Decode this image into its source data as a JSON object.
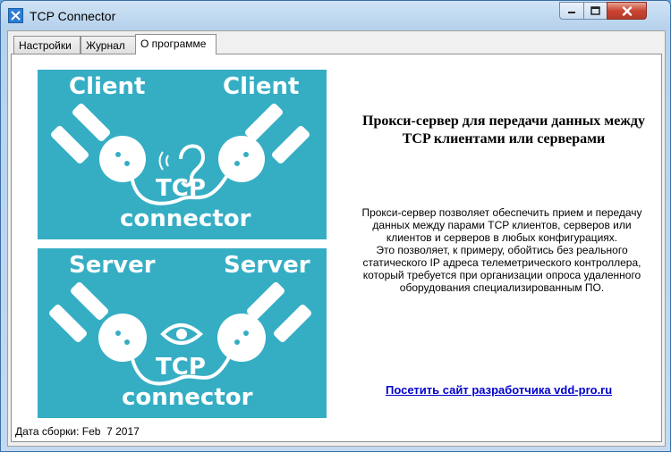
{
  "window": {
    "title": "TCP Connector"
  },
  "tabs": [
    {
      "label": "Настройки"
    },
    {
      "label": "Журнал"
    },
    {
      "label": "О программе",
      "active": true
    }
  ],
  "logo": {
    "top": {
      "left_word": "Client",
      "right_word": "Client",
      "center": "TCP",
      "bottom": "connector",
      "icon": "ear-icon"
    },
    "bottom": {
      "left_word": "Server",
      "right_word": "Server",
      "center": "TCP",
      "bottom": "connector",
      "icon": "eye-icon"
    },
    "color": "#35aec4"
  },
  "about": {
    "heading": "Прокси-сервер для передачи данных между TCP клиентами или серверами",
    "description": [
      "Прокси-сервер позволяет обеспечить прием и передачу данных между парами TCP клиентов, серверов или клиентов и серверов в любых конфигурациях.",
      "Это позволяет, к примеру, обойтись без реального статического IP адреса телеметрического контроллера, который требуется при организации опроса удаленного оборудования специализированным ПО."
    ],
    "link_text": "Посетить сайт разработчика vdd-pro.ru"
  },
  "build": {
    "label": "Дата сборки:",
    "date": "Feb  7 2017"
  }
}
